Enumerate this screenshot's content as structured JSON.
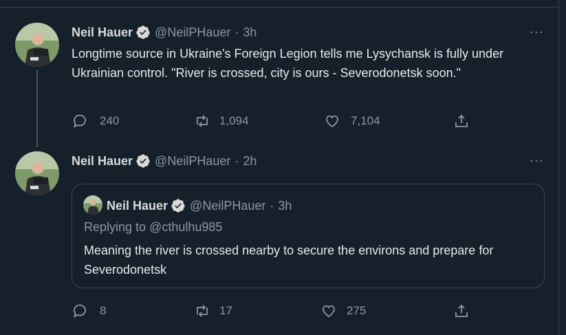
{
  "tweets": [
    {
      "name": "Neil Hauer",
      "handle": "@NeilPHauer",
      "dot": "·",
      "time": "3h",
      "more": "···",
      "text": "Longtime source in Ukraine's Foreign Legion tells me Lysychansk is fully under Ukrainian control. \"River is crossed, city is ours - Severodonetsk soon.\"",
      "replies": "240",
      "retweets": "1,094",
      "likes": "7,104"
    },
    {
      "name": "Neil Hauer",
      "handle": "@NeilPHauer",
      "dot": "·",
      "time": "2h",
      "more": "···",
      "replies": "8",
      "retweets": "17",
      "likes": "275",
      "quote": {
        "name": "Neil Hauer",
        "handle": "@NeilPHauer",
        "dot": "·",
        "time": "3h",
        "replying_to": "Replying to @cthulhu985",
        "text": "Meaning the river is crossed nearby to secure the environs and prepare for Severodonetsk"
      }
    }
  ],
  "icons": {
    "reply": "reply-icon",
    "retweet": "retweet-icon",
    "like": "heart-icon",
    "share": "share-icon",
    "verified": "verified-badge-icon"
  },
  "colors": {
    "background": "#15202b",
    "border": "#38444d",
    "muted": "#8b98a5",
    "text": "#e7e9ea"
  }
}
